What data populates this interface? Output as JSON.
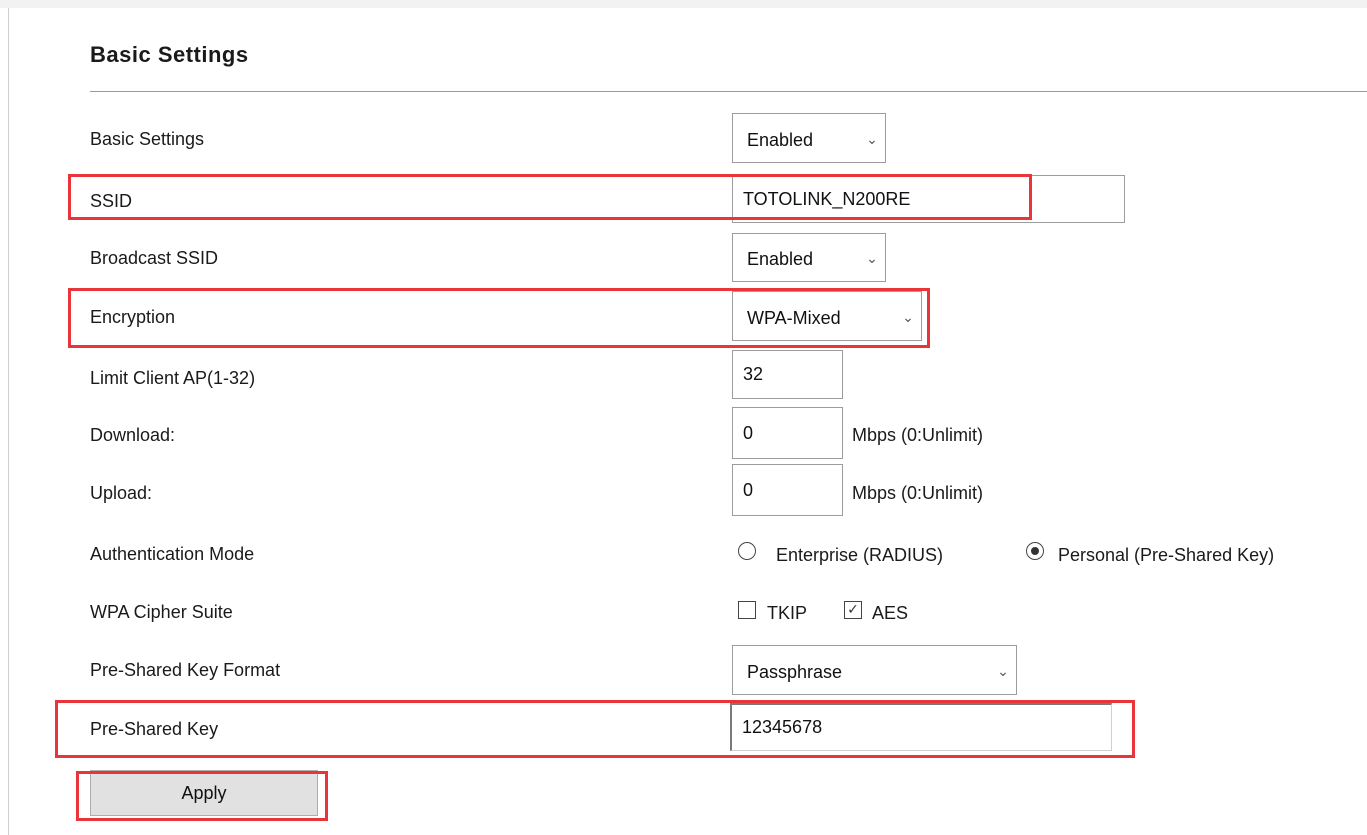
{
  "section": {
    "title": "Basic Settings"
  },
  "fields": {
    "basic_settings": {
      "label": "Basic Settings",
      "value": "Enabled"
    },
    "ssid": {
      "label": "SSID",
      "value": "TOTOLINK_N200RE"
    },
    "broadcast_ssid": {
      "label": "Broadcast SSID",
      "value": "Enabled"
    },
    "encryption": {
      "label": "Encryption",
      "value": "WPA-Mixed"
    },
    "limit_client": {
      "label": "Limit Client AP(1-32)",
      "value": "32"
    },
    "download": {
      "label": "Download:",
      "value": "0",
      "unit": "Mbps (0:Unlimit)"
    },
    "upload": {
      "label": "Upload:",
      "value": "0",
      "unit": "Mbps (0:Unlimit)"
    },
    "auth_mode": {
      "label": "Authentication Mode",
      "options": [
        "Enterprise (RADIUS)",
        "Personal (Pre-Shared Key)"
      ],
      "selected": "Personal (Pre-Shared Key)"
    },
    "cipher": {
      "label": "WPA Cipher Suite",
      "options": [
        {
          "label": "TKIP",
          "checked": false
        },
        {
          "label": "AES",
          "checked": true
        }
      ]
    },
    "psk_format": {
      "label": "Pre-Shared Key Format",
      "value": "Passphrase"
    },
    "psk": {
      "label": "Pre-Shared Key",
      "value": "12345678"
    }
  },
  "apply_label": "Apply",
  "colors": {
    "highlight": "#e8353b",
    "button_bg": "#e1e1e1"
  },
  "icons": {
    "dropdown": "chevron-down-icon",
    "radio_selected": "radio-checked-icon",
    "checkbox_checked": "checkbox-checked-icon"
  }
}
